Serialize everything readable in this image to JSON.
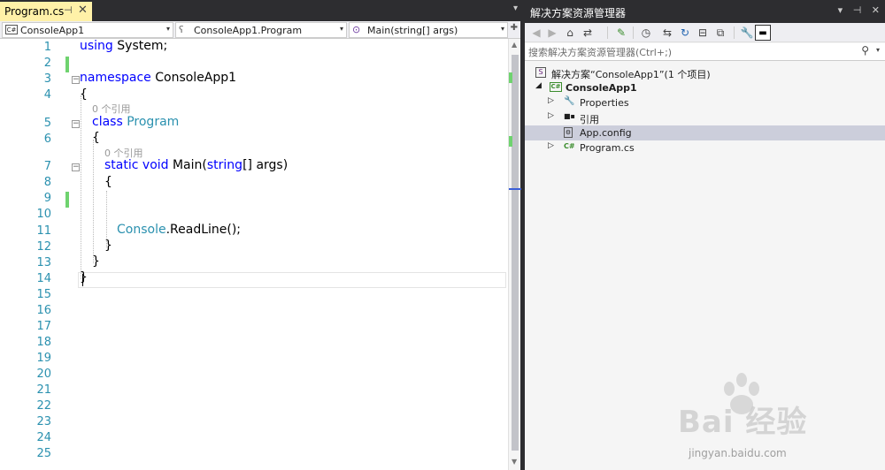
{
  "editor": {
    "tab": {
      "title": "Program.cs",
      "pin": "⊣",
      "close": "✕"
    },
    "tabstrip_menu": "▾",
    "nav": {
      "project": {
        "icon": "C#",
        "label": "ConsoleApp1"
      },
      "type": {
        "icon": "ʕ",
        "label": "ConsoleApp1.Program"
      },
      "member": {
        "icon": "⊙",
        "label": "Main(string[] args)"
      },
      "caret": "▾",
      "split": "✚"
    },
    "line_numbers": [
      "1",
      "2",
      "3",
      "4",
      "5",
      "6",
      "7",
      "8",
      "9",
      "10",
      "11",
      "12",
      "13",
      "14",
      "15",
      "16",
      "17",
      "18",
      "19",
      "20",
      "21",
      "22",
      "23",
      "24",
      "25"
    ],
    "code": {
      "l1_kw": "using",
      "l1_rest": " System;",
      "l3_kw": "namespace",
      "l3_rest": " ConsoleApp1",
      "open_brace": "{",
      "close_brace": "}",
      "ref_count": "0 个引用",
      "l5_kw": "class",
      "l5_type": " Program",
      "l7_kw1": "static",
      "l7_kw2": " void",
      "l7_name": " Main(",
      "l7_type": "string",
      "l7_rest": "[] args)",
      "l11_type": "Console",
      "l11_rest": ".ReadLine();"
    },
    "fold_glyph": "−"
  },
  "solution_explorer": {
    "title": "解决方案资源管理器",
    "title_buttons": [
      "▾",
      "⊣",
      "✕"
    ],
    "toolbar": {
      "back": "◀",
      "forward": "▶",
      "home": "⌂",
      "switch_views": "⇄",
      "pending_changes": "✎",
      "history": "◷",
      "sync": "⇆",
      "refresh": "↻",
      "collapse_all": "⊟",
      "show_all": "⧉",
      "properties": "🔧",
      "preview": "▬"
    },
    "search": {
      "placeholder": "搜索解决方案资源管理器(Ctrl+;)",
      "icon": "⚲",
      "options": "▾"
    },
    "tree": {
      "solution": {
        "icon": "S",
        "label": "解决方案“ConsoleApp1”(1 个项目)"
      },
      "project": {
        "expander": "◢",
        "icon": "C#",
        "label": "ConsoleApp1"
      },
      "properties": {
        "expander": "▷",
        "icon": "🔧",
        "label": "Properties"
      },
      "references": {
        "expander": "▷",
        "icon": "■▪",
        "label": "引用"
      },
      "app_config": {
        "icon": "⚙",
        "label": "App.config"
      },
      "program_cs": {
        "expander": "▷",
        "icon": "C#",
        "label": "Program.cs"
      }
    }
  },
  "watermark": {
    "brand": "Bai  经验",
    "url": "jingyan.baidu.com"
  }
}
